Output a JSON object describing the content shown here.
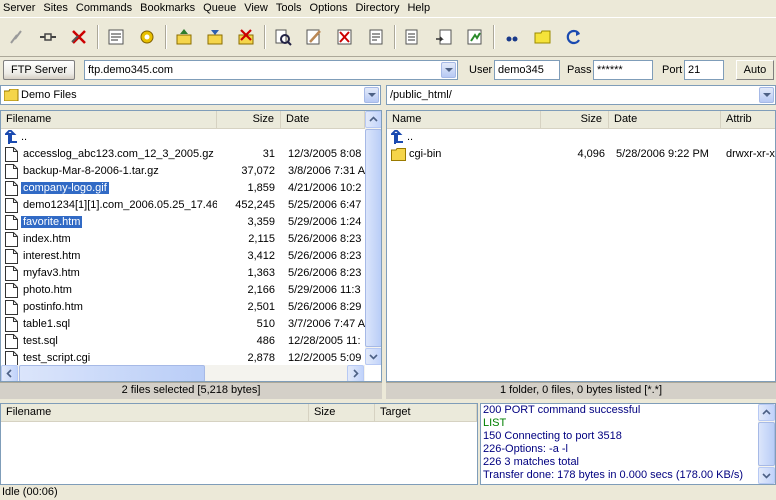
{
  "menu": [
    "Server",
    "Sites",
    "Commands",
    "Bookmarks",
    "Queue",
    "View",
    "Tools",
    "Options",
    "Directory",
    "Help"
  ],
  "toolbar_icons": [
    "disconnect-icon",
    "reconnect-icon",
    "abort-icon",
    "view-log-icon",
    "settings-icon",
    "upload-icon",
    "download-icon",
    "delete-icon",
    "search-icon",
    "rename-icon",
    "cancel-icon",
    "properties-icon",
    "compare-icon",
    "sync-icon",
    "transfer-icon",
    "quote-icon",
    "folder-icon",
    "refresh-icon"
  ],
  "connection": {
    "server_type": "FTP Server",
    "host": "ftp.demo345.com",
    "user_label": "User",
    "user": "demo345",
    "pass_label": "Pass",
    "pass": "******",
    "port_label": "Port",
    "port": "21",
    "auto": "Auto"
  },
  "local": {
    "path": "Demo Files",
    "headers": [
      "Filename",
      "Size",
      "Date"
    ],
    "up": "..",
    "files": [
      {
        "name": "accesslog_abc123.com_12_3_2005.gz",
        "size": "31",
        "date": "12/3/2005 8:08",
        "selected": false
      },
      {
        "name": "backup-Mar-8-2006-1.tar.gz",
        "size": "37,072",
        "date": "3/8/2006 7:31 A",
        "selected": false
      },
      {
        "name": "company-logo.gif",
        "size": "1,859",
        "date": "4/21/2006 10:2",
        "selected": true
      },
      {
        "name": "demo1234[1][1].com_2006.05.25_17.46",
        "size": "452,245",
        "date": "5/25/2006 6:47",
        "selected": false
      },
      {
        "name": "favorite.htm",
        "size": "3,359",
        "date": "5/29/2006 1:24",
        "selected": true
      },
      {
        "name": "index.htm",
        "size": "2,115",
        "date": "5/26/2006 8:23",
        "selected": false
      },
      {
        "name": "interest.htm",
        "size": "3,412",
        "date": "5/26/2006 8:23",
        "selected": false
      },
      {
        "name": "myfav3.htm",
        "size": "1,363",
        "date": "5/26/2006 8:23",
        "selected": false
      },
      {
        "name": "photo.htm",
        "size": "2,166",
        "date": "5/29/2006 11:3",
        "selected": false
      },
      {
        "name": "postinfo.htm",
        "size": "2,501",
        "date": "5/26/2006 8:29",
        "selected": false
      },
      {
        "name": "table1.sql",
        "size": "510",
        "date": "3/7/2006 7:47 A",
        "selected": false
      },
      {
        "name": "test.sql",
        "size": "486",
        "date": "12/28/2005 11:",
        "selected": false
      },
      {
        "name": "test_script.cgi",
        "size": "2,878",
        "date": "12/2/2005 5:09",
        "selected": false
      }
    ],
    "status": "2 files selected [5,218 bytes]"
  },
  "remote": {
    "path": "/public_html/",
    "headers": [
      "Name",
      "Size",
      "Date",
      "Attrib"
    ],
    "up": "..",
    "files": [
      {
        "name": "cgi-bin",
        "size": "4,096",
        "date": "5/28/2006 9:22 PM",
        "attrib": "drwxr-xr-x"
      }
    ],
    "status": "1 folder, 0 files, 0 bytes listed [*.*]"
  },
  "queue": {
    "headers": [
      "Filename",
      "Size",
      "Target"
    ]
  },
  "log": [
    {
      "text": "200 PORT command successful",
      "color": "blue"
    },
    {
      "text": "LIST",
      "color": "green"
    },
    {
      "text": "150 Connecting to port 3518",
      "color": "blue"
    },
    {
      "text": "226-Options: -a -l",
      "color": "blue"
    },
    {
      "text": "226 3 matches total",
      "color": "blue"
    },
    {
      "text": "Transfer done: 178 bytes in 0.000 secs (178.00 KB/s)",
      "color": "blue"
    }
  ],
  "statusbar": "Idle (00:06)"
}
